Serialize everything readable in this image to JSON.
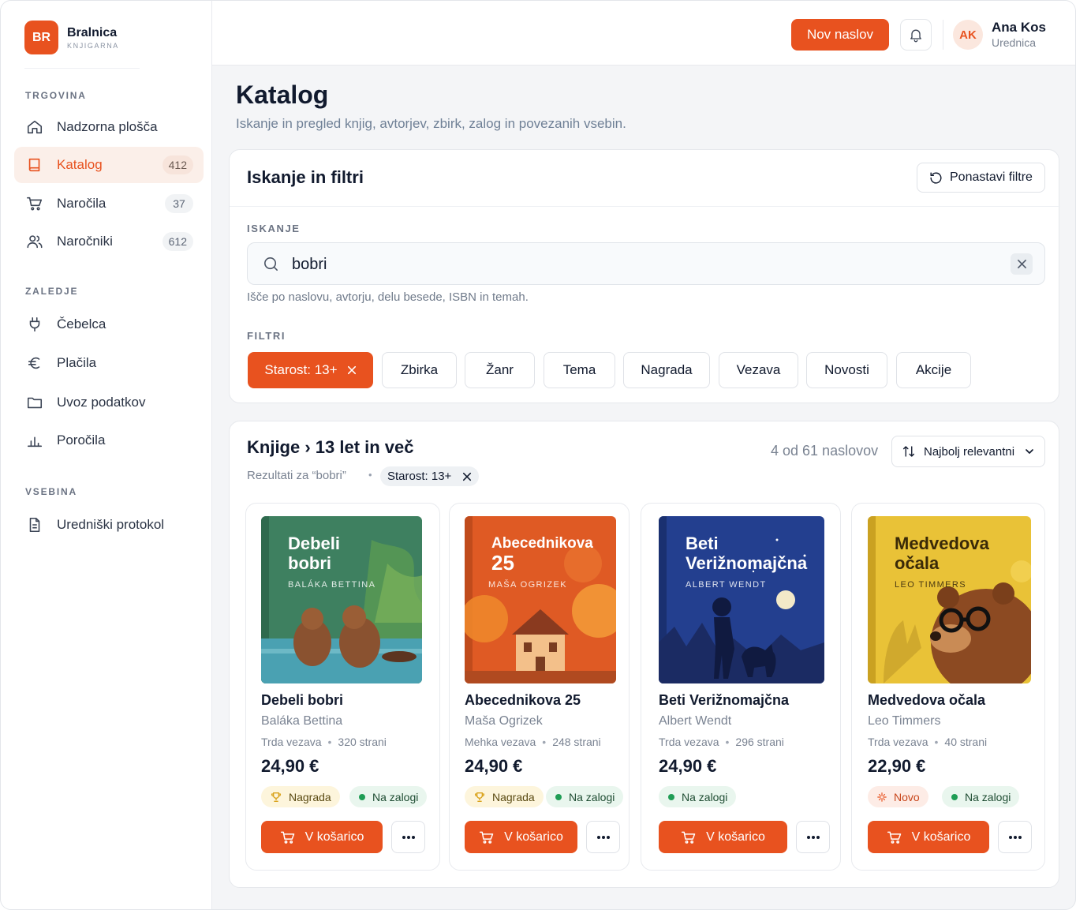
{
  "brand": {
    "initials": "BR",
    "name": "Bralnica",
    "subtitle": "KNJIGARNA"
  },
  "sidebar": {
    "sections": [
      {
        "title": "TRGOVINA",
        "items": [
          {
            "label": "Nadzorna plošča",
            "icon": "home-icon",
            "badge": ""
          },
          {
            "label": "Katalog",
            "icon": "book-icon",
            "badge": "412",
            "active": true
          },
          {
            "label": "Naročila",
            "icon": "cart-icon",
            "badge": "37"
          },
          {
            "label": "Naročniki",
            "icon": "users-icon",
            "badge": "612"
          }
        ]
      },
      {
        "title": "ZALEDJE",
        "items": [
          {
            "label": "Čebelca",
            "icon": "plug-icon"
          },
          {
            "label": "Plačila",
            "icon": "euro-icon"
          },
          {
            "label": "Uvoz podatkov",
            "icon": "folder-icon"
          },
          {
            "label": "Poročila",
            "icon": "bar-chart-icon"
          }
        ]
      },
      {
        "title": "VSEBINA",
        "items": [
          {
            "label": "Uredniški protokol",
            "icon": "document-icon"
          }
        ]
      }
    ]
  },
  "topbar": {
    "new_title_label": "Nov naslov",
    "user": {
      "initials": "AK",
      "name": "Ana Kos",
      "role": "Urednica"
    }
  },
  "page": {
    "title": "Katalog",
    "subtitle": "Iskanje in pregled knjig, avtorjev, zbirk, zalog in povezanih vsebin."
  },
  "filters": {
    "title": "Iskanje in filtri",
    "reset_label": "Ponastavi filtre",
    "search_label": "ISKANJE",
    "search_value": "bobri",
    "search_hint": "Išče po naslovu, avtorju, delu besede, ISBN in temah.",
    "filters_label": "FILTRI",
    "chips": [
      {
        "label": "Starost: 13+",
        "active": true
      },
      {
        "label": "Zbirka"
      },
      {
        "label": "Žanr"
      },
      {
        "label": "Tema"
      },
      {
        "label": "Nagrada"
      },
      {
        "label": "Vezava"
      },
      {
        "label": "Novosti"
      },
      {
        "label": "Akcije"
      }
    ]
  },
  "results": {
    "title": "Knjige › 13 let in več",
    "query_text": "Rezultati za “bobri”",
    "separator": "•",
    "active_chip": "Starost: 13+",
    "count": "4 od 61 naslovov",
    "sort_label": "Najbolj relevantni",
    "books": [
      {
        "title": "Debeli bobri",
        "cover_title_1": "Debeli",
        "cover_title_2": "bobri",
        "cover_author": "BALÁKA BETTINA",
        "author": "Baláka Bettina",
        "binding": "Trda vezava",
        "pages": "320 strani",
        "price": "24,90 €",
        "tags": [
          "Nagrada",
          "Na zalogi"
        ],
        "cart_label": "V košarico",
        "cover_color": "#3e8060"
      },
      {
        "title": "Abecednikova 25",
        "cover_title_1": "Abecednikova",
        "cover_title_2": "25",
        "cover_author": "MAŠA OGRIZEK",
        "author": "Maša Ogrizek",
        "binding": "Mehka vezava",
        "pages": "248 strani",
        "price": "24,90 €",
        "tags": [
          "Nagrada",
          "Na zalogi"
        ],
        "cart_label": "V košarico",
        "cover_color": "#df5a24"
      },
      {
        "title": "Beti Verižnomajčna",
        "cover_title_1": "Beti",
        "cover_title_2": "Verižnomajčna",
        "cover_author": "ALBERT WENDT",
        "author": "Albert Wendt",
        "binding": "Trda vezava",
        "pages": "296 strani",
        "price": "24,90 €",
        "tags": [
          "Na zalogi"
        ],
        "cart_label": "V košarico",
        "cover_color": "#233f8f"
      },
      {
        "title": "Medvedova očala",
        "cover_title_1": "Medvedova",
        "cover_title_2": "očala",
        "cover_author": "LEO TIMMERS",
        "author": "Leo Timmers",
        "binding": "Trda vezava",
        "pages": "40 strani",
        "price": "22,90 €",
        "tags": [
          "Novo",
          "Na zalogi"
        ],
        "cart_label": "V košarico",
        "cover_color": "#e9c237"
      }
    ]
  },
  "colors": {
    "accent": "#e8521f",
    "success": "#1f9d55",
    "award": "#d9a21b"
  }
}
